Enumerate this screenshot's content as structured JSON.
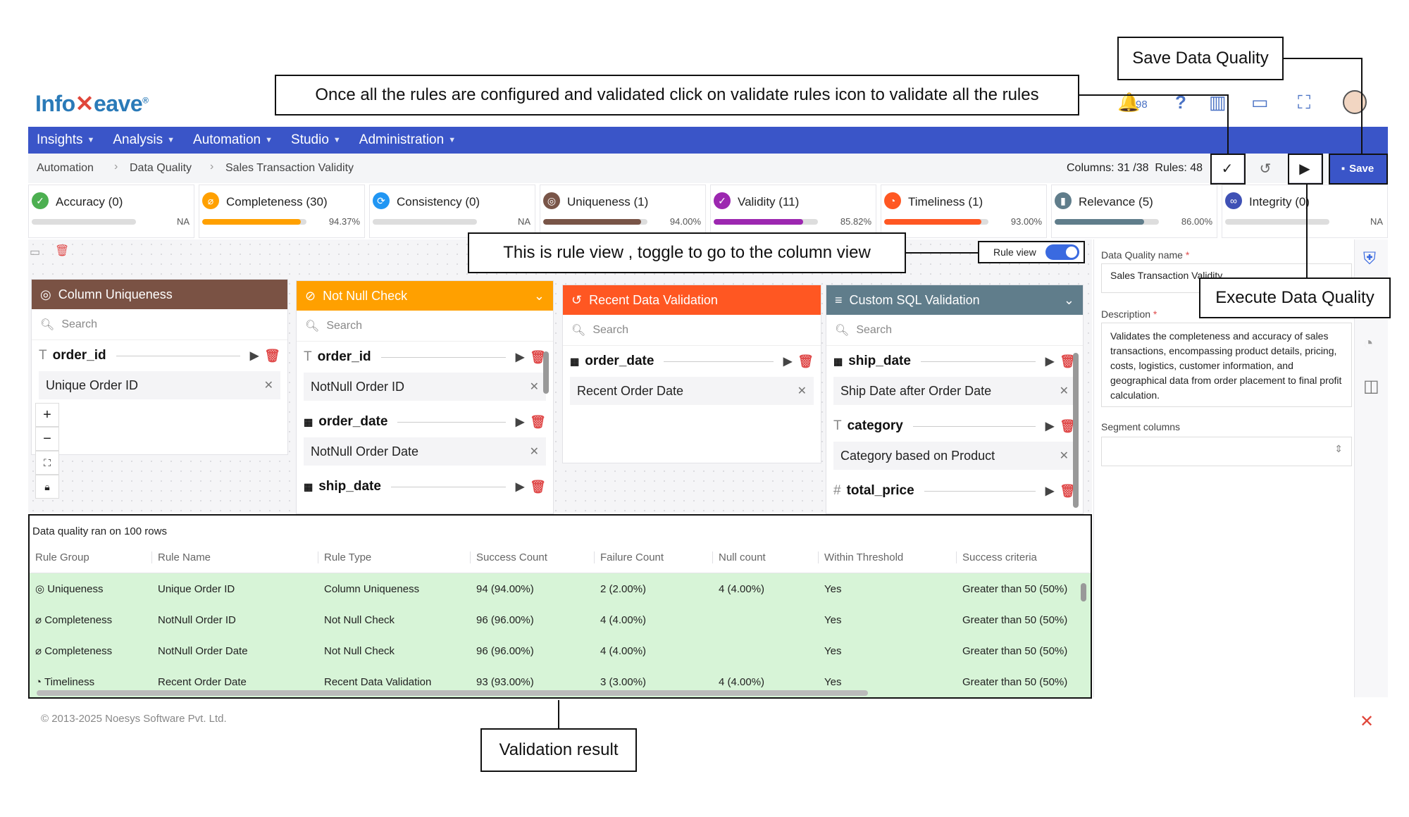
{
  "logo": {
    "text_a": "Info",
    "text_b": "eave",
    "reg": "®"
  },
  "notifications": {
    "count": "98"
  },
  "nav": [
    {
      "label": "Insights"
    },
    {
      "label": "Analysis"
    },
    {
      "label": "Automation"
    },
    {
      "label": "Studio"
    },
    {
      "label": "Administration"
    }
  ],
  "breadcrumb": [
    "Automation",
    "Data Quality",
    "Sales Transaction Validity"
  ],
  "toolbar": {
    "columns": "Columns: 31 /38",
    "rules": "Rules: 48",
    "save_label": "Save"
  },
  "metrics": [
    {
      "label": "Accuracy (0)",
      "value": "NA",
      "fill": 0,
      "color": "#4caf50"
    },
    {
      "label": "Completeness (30)",
      "value": "94.37%",
      "fill": 0.9437,
      "color": "#ffa000"
    },
    {
      "label": "Consistency (0)",
      "value": "NA",
      "fill": 0,
      "color": "#2196f3"
    },
    {
      "label": "Uniqueness (1)",
      "value": "94.00%",
      "fill": 0.94,
      "color": "#795548"
    },
    {
      "label": "Validity (11)",
      "value": "85.82%",
      "fill": 0.8582,
      "color": "#9c27b0"
    },
    {
      "label": "Timeliness (1)",
      "value": "93.00%",
      "fill": 0.93,
      "color": "#ff5722"
    },
    {
      "label": "Relevance (5)",
      "value": "86.00%",
      "fill": 0.86,
      "color": "#607d8b"
    },
    {
      "label": "Integrity (0)",
      "value": "NA",
      "fill": 0,
      "color": "#3f51b5"
    }
  ],
  "rule_view": {
    "label": "Rule view",
    "on": true
  },
  "cards": {
    "uniqueness": {
      "title": "Column Uniqueness",
      "search": "Search",
      "col1": "order_id",
      "rule1": "Unique Order ID"
    },
    "notnull": {
      "title": "Not Null Check",
      "search": "Search",
      "col1": "order_id",
      "rule1": "NotNull Order ID",
      "col2": "order_date",
      "rule2": "NotNull Order Date",
      "col3": "ship_date"
    },
    "recent": {
      "title": "Recent Data Validation",
      "search": "Search",
      "col1": "order_date",
      "rule1": "Recent Order Date"
    },
    "customsql": {
      "title": "Custom SQL Validation",
      "search": "Search",
      "col1": "ship_date",
      "rule1": "Ship Date after Order Date",
      "col2": "category",
      "rule2": "Category based on Product",
      "col3": "total_price"
    }
  },
  "panel": {
    "name_label": "Data Quality name",
    "name_value": "Sales Transaction Validity",
    "desc_label": "Description",
    "desc_value": "Validates the completeness and accuracy of sales transactions, encompassing product details, pricing, costs, logistics, customer information, and geographical data from order placement to final profit calculation.",
    "segment_label": "Segment columns"
  },
  "results": {
    "heading": "Data quality ran on 100 rows",
    "columns": [
      "Rule Group",
      "Rule Name",
      "Rule Type",
      "Success Count",
      "Failure Count",
      "Null count",
      "Within Threshold",
      "Success criteria"
    ],
    "rows": [
      [
        "Uniqueness",
        "Unique Order ID",
        "Column Uniqueness",
        "94 (94.00%)",
        "2 (2.00%)",
        "4 (4.00%)",
        "Yes",
        "Greater than 50 (50%)"
      ],
      [
        "Completeness",
        "NotNull Order ID",
        "Not Null Check",
        "96 (96.00%)",
        "4 (4.00%)",
        "",
        "Yes",
        "Greater than 50 (50%)"
      ],
      [
        "Completeness",
        "NotNull Order Date",
        "Not Null Check",
        "96 (96.00%)",
        "4 (4.00%)",
        "",
        "Yes",
        "Greater than 50 (50%)"
      ],
      [
        "Timeliness",
        "Recent Order Date",
        "Recent Data Validation",
        "93 (93.00%)",
        "3 (3.00%)",
        "4 (4.00%)",
        "Yes",
        "Greater than 50 (50%)"
      ]
    ]
  },
  "footer": "© 2013-2025 Noesys Software Pvt. Ltd.",
  "callouts": {
    "save": "Save Data Quality",
    "validate": "Once all the rules are configured and validated click on validate rules icon to validate all the rules",
    "ruleview": "This is rule view , toggle to go to the column view",
    "execute": "Execute Data Quality",
    "result": "Validation result"
  }
}
